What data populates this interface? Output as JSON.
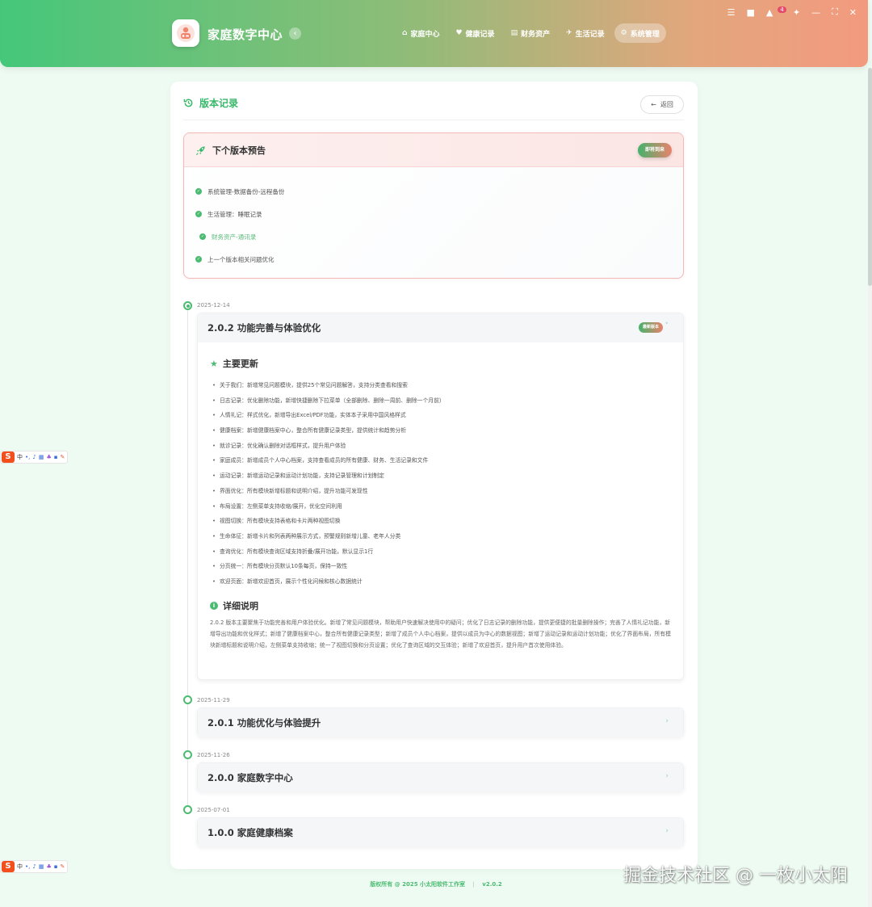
{
  "app": {
    "title": "家庭数字中心",
    "collapse_icon": "‹"
  },
  "nav": [
    {
      "icon": "⌂",
      "label": "家庭中心"
    },
    {
      "icon": "♥",
      "label": "健康记录"
    },
    {
      "icon": "▤",
      "label": "财务资产"
    },
    {
      "icon": "✈",
      "label": "生活记录"
    },
    {
      "icon": "⚙",
      "label": "系统管理"
    }
  ],
  "window": {
    "notification_count": "4"
  },
  "page": {
    "title": "版本记录",
    "back_label": "返回"
  },
  "preview": {
    "title": "下个版本预告",
    "badge": "即将到来",
    "items": [
      "系统管理-数据备份-远程备份",
      "生活管理：睡眠记录",
      "财务资产-通讯录",
      "上一个版本相关问题优化"
    ]
  },
  "versions": [
    {
      "date": "2025-12-14",
      "title": "2.0.2 功能完善与体验优化",
      "badge": "最新版本",
      "main_updates_title": "主要更新",
      "updates": [
        "关于我们：新增常见问题模块，提供25个常见问题解答，支持分类查看和搜索",
        "日志记录：优化删除功能，新增快捷删除下拉菜单（全部删除、删除一周前、删除一个月前）",
        "人情礼记：样式优化，新增导出Excel/PDF功能，实体本子采用中国风格样式",
        "健康档案：新增健康档案中心，整合所有健康记录类型，提供统计和趋势分析",
        "就诊记录：优化确认删除对话框样式，提升用户体验",
        "家庭成员：新增成员个人中心档案，支持查看成员的所有健康、财务、生活记录和文件",
        "运动记录：新增运动记录和运动计划功能，支持记录管理和计划制定",
        "界面优化：所有模块新增标题和说明介绍，提升功能可发现性",
        "布局设置：左侧菜单支持收缩/展开，优化空间利用",
        "视图切换：所有模块支持表格和卡片两种视图切换",
        "生命体征：新增卡片和列表两种展示方式，预警规则新增儿童、老年人分类",
        "查询优化：所有模块查询区域支持折叠/展开功能，默认显示1行",
        "分页统一：所有模块分页默认10条每页，保持一致性",
        "欢迎页面：新增欢迎首页，展示个性化问候和核心数据统计"
      ],
      "detail_title": "详细说明",
      "detail": "2.0.2 版本主要聚焦于功能完善和用户体验优化。新增了常见问题模块，帮助用户快速解决使用中的疑问；优化了日志记录的删除功能，提供更便捷的批量删除操作；完善了人情礼记功能，新增导出功能和优化样式；新增了健康档案中心，整合所有健康记录类型；新增了成员个人中心档案，提供以成员为中心的数据视图；新增了运动记录和运动计划功能；优化了界面布局，所有模块新增标题和说明介绍，左侧菜单支持收缩；统一了视图切换和分页设置；优化了查询区域的交互体验；新增了欢迎首页，提升用户首次使用体验。"
    },
    {
      "date": "2025-11-29",
      "title": "2.0.1 功能优化与体验提升"
    },
    {
      "date": "2025-11-26",
      "title": "2.0.0 家庭数字中心"
    },
    {
      "date": "2025-07-01",
      "title": "1.0.0 家庭健康档案"
    }
  ],
  "footer": {
    "copyright": "版权所有 @ 2025 小太阳软件工作室",
    "version": "v2.0.2"
  },
  "ime": {
    "logo": "S",
    "mode": "中"
  },
  "watermark": "掘金技术社区 @ 一枚小太阳",
  "colors": {
    "accent": "#4cbb72",
    "header_start": "#45c77a",
    "header_end": "#f39a7e",
    "badge_end": "#e9826c"
  }
}
